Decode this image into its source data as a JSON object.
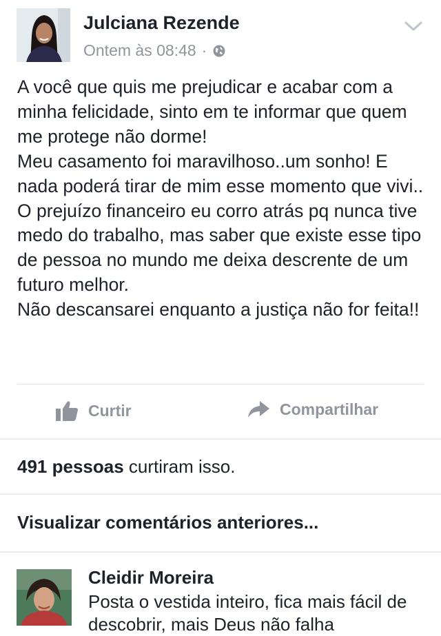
{
  "post": {
    "author": "Julciana Rezende",
    "timestamp": "Ontem às 08:48",
    "meta_separator": "·",
    "privacy_icon": "globe-icon",
    "menu_icon": "chevron-down-icon",
    "body_lines": [
      "A você que quis me prejudicar e acabar com a minha felicidade, sinto em te informar que quem me protege não dorme!",
      "Meu casamento foi maravilhoso..um sonho! E nada poderá tirar de mim esse momento que vivi..",
      "O prejuízo financeiro eu corro atrás pq nunca tive medo do trabalho, mas saber que existe esse tipo de pessoa no mundo me deixa descrente de um futuro melhor.",
      "Não descansarei enquanto a justiça não for feita!!"
    ]
  },
  "actions": {
    "like_label": "Curtir",
    "like_icon": "thumbs-up-icon",
    "share_label": "Compartilhar",
    "share_icon": "share-arrow-icon"
  },
  "likes": {
    "count_text": "491 pessoas",
    "suffix_text": "curtiram isso."
  },
  "comments": {
    "view_previous_label": "Visualizar comentários anteriores...",
    "items": [
      {
        "author": "Cleidir Moreira",
        "text": "Posta o vestida inteiro,  fica mais fácil de descobrir, mais Deus não falha"
      }
    ]
  },
  "colors": {
    "text_primary": "#1d2129",
    "text_secondary": "#90949c",
    "divider": "#e9ebee"
  }
}
